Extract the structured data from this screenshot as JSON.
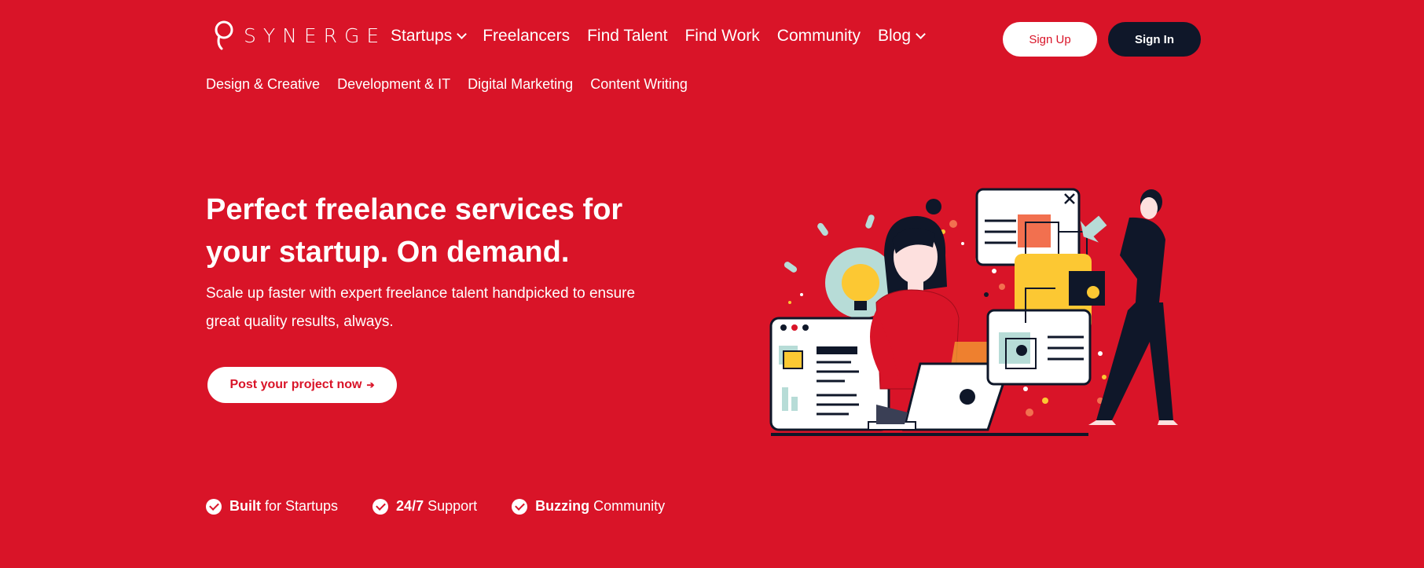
{
  "brand": {
    "name": "SYNERGE"
  },
  "nav": {
    "items": [
      {
        "label": "Startups",
        "has_dropdown": true
      },
      {
        "label": "Freelancers",
        "has_dropdown": false
      },
      {
        "label": "Find Talent",
        "has_dropdown": false
      },
      {
        "label": "Find Work",
        "has_dropdown": false
      },
      {
        "label": "Community",
        "has_dropdown": false
      },
      {
        "label": "Blog",
        "has_dropdown": true
      }
    ],
    "signup_label": "Sign Up",
    "signin_label": "Sign In"
  },
  "subnav": {
    "items": [
      "Design & Creative",
      "Development & IT",
      "Digital Marketing",
      "Content Writing"
    ]
  },
  "hero": {
    "title_line1": "Perfect freelance services for",
    "title_line2": "your startup. On demand.",
    "subtitle": "Scale up faster with expert freelance talent handpicked to ensure great quality results, always.",
    "cta_label": "Post your project now",
    "cta_arrow": "➔"
  },
  "features": [
    {
      "bold": "Built",
      "rest": " for Startups"
    },
    {
      "bold": "24/7",
      "rest": " Support"
    },
    {
      "bold": "Buzzing",
      "rest": " Community"
    }
  ],
  "colors": {
    "background": "#d91428",
    "dark": "#0f1729",
    "accent_yellow": "#fcc833",
    "accent_teal": "#b7dcd7",
    "white": "#ffffff"
  }
}
